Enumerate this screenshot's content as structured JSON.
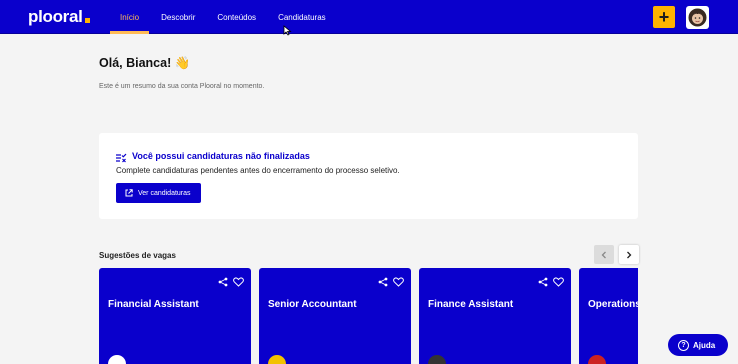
{
  "brand": {
    "name": "plooral"
  },
  "nav": {
    "items": [
      "Início",
      "Descobrir",
      "Conteúdos",
      "Candidaturas"
    ],
    "active": "Início"
  },
  "header": {
    "plus_label": "+"
  },
  "greeting": {
    "title": "Olá, Bianca! 👋",
    "subtitle": "Este é um resumo da sua conta Plooral no momento."
  },
  "pending": {
    "title": "Você possui candidaturas não finalizadas",
    "description": "Complete candidaturas pendentes antes do encerramento do processo seletivo.",
    "button_label": "Ver candidaturas"
  },
  "suggestions": {
    "title": "Sugestões de vagas",
    "cards": [
      {
        "title": "Financial Assistant"
      },
      {
        "title": "Senior Accountant"
      },
      {
        "title": "Finance Assistant"
      },
      {
        "title": "Operations"
      }
    ]
  },
  "help": {
    "label": "Ajuda"
  },
  "colors": {
    "primary": "#0a00cc",
    "accent": "#ffb300",
    "nav_active": "#ffbb55"
  }
}
